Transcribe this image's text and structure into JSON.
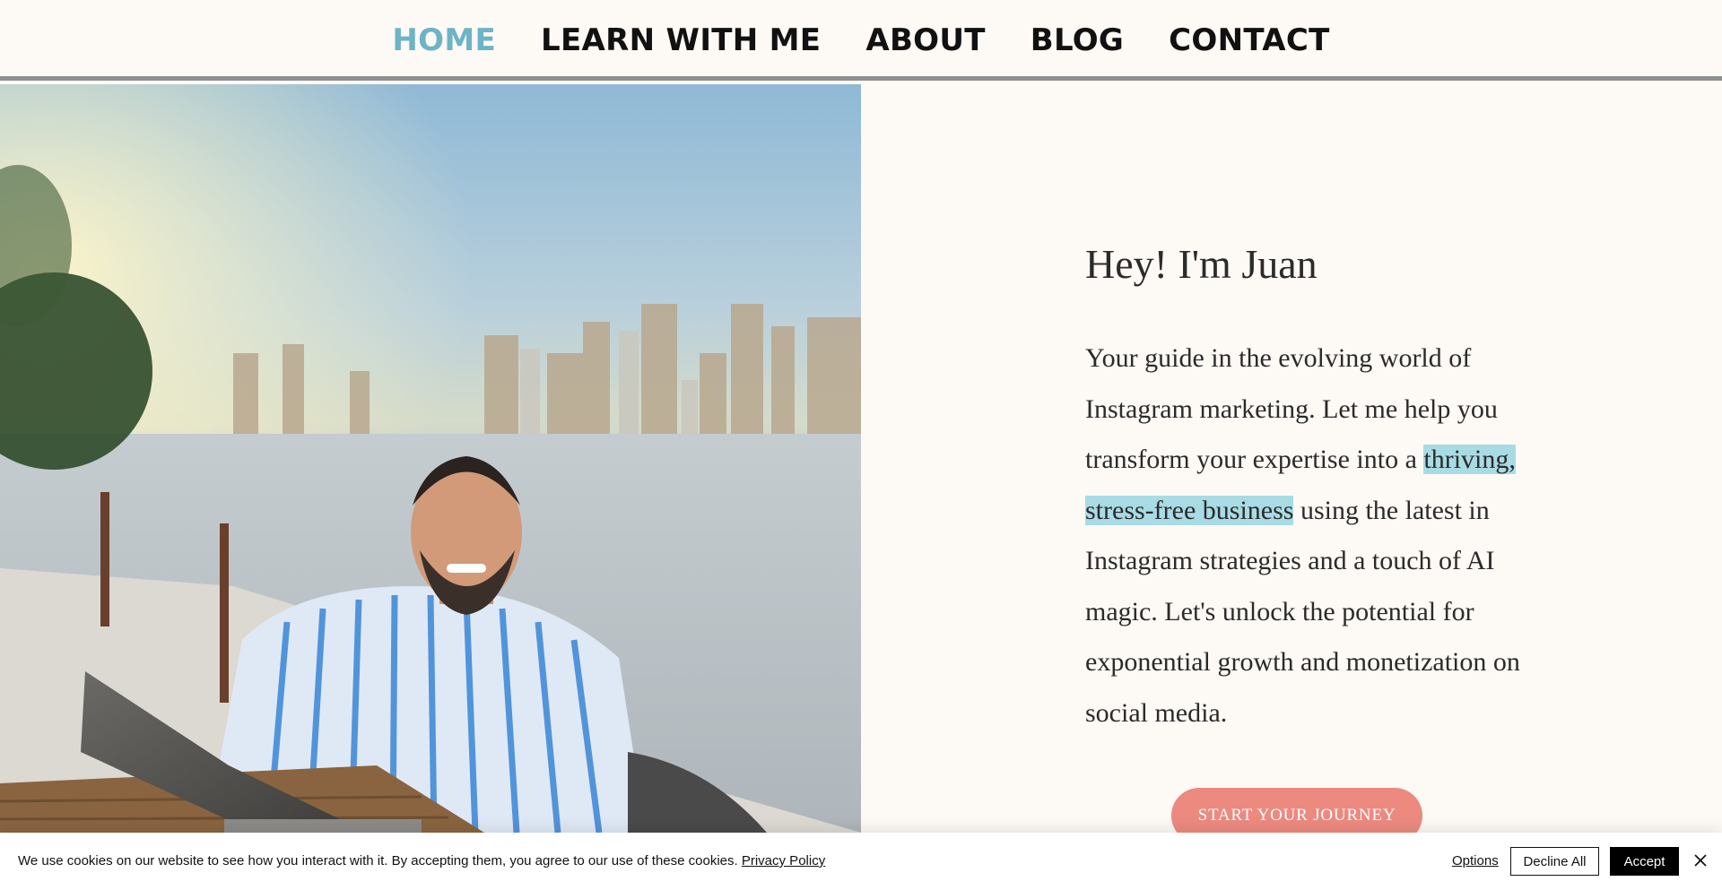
{
  "nav": {
    "items": [
      {
        "label": "HOME",
        "active": true
      },
      {
        "label": "LEARN WITH ME",
        "active": false
      },
      {
        "label": "ABOUT",
        "active": false
      },
      {
        "label": "BLOG",
        "active": false
      },
      {
        "label": "CONTACT",
        "active": false
      }
    ],
    "active_color": "#6cb4c6"
  },
  "hero": {
    "title": "Hey! I'm Juan",
    "text_before": "Your guide in the evolving world of Instagram marketing. Let me help you transform your expertise into a ",
    "text_highlight": "thriving, stress-free business",
    "text_after": " using the latest in Instagram strategies and a touch of AI magic. Let's unlock the potential for exponential growth and monetization on social media.",
    "cta_label": "START YOUR JOURNEY",
    "cta_color": "#ec8a80",
    "highlight_color": "#a9dbe4"
  },
  "cookie_banner": {
    "text": "We use cookies on our website to see how you interact with it. By accepting them, you agree to our use of these cookies.",
    "privacy_link": "Privacy Policy",
    "options_label": "Options",
    "decline_label": "Decline All",
    "accept_label": "Accept",
    "close_icon": "close-icon"
  }
}
